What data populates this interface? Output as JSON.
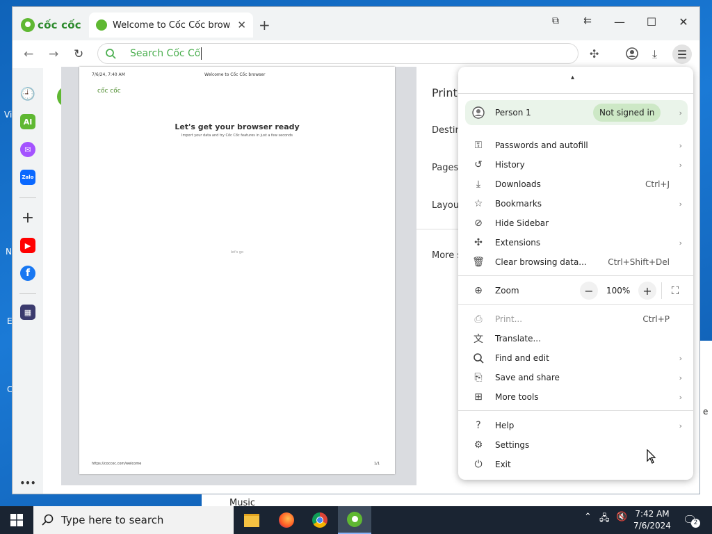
{
  "desktop": {
    "fragments": [
      "Vi",
      "N",
      "E",
      "C"
    ],
    "music_label": "Music",
    "explorer_fragment": "e"
  },
  "browser": {
    "logo_text": "cốc cốc",
    "tab": {
      "title": "Welcome to Cốc Cốc browse",
      "close": "✕"
    },
    "new_tab": "+",
    "window_controls": {
      "minimize": "—",
      "maximize": "☐",
      "close": "✕"
    },
    "omnibox": {
      "placeholder": "Search Cốc Cốc",
      "value": ""
    }
  },
  "print_preview": {
    "header_left": "7/6/24, 7:40 AM",
    "header_center": "Welcome to Cốc Cốc browser",
    "logo": "cốc cốc",
    "heading": "Let's get your browser ready",
    "subheading": "Import your data and try Cốc Cốc features in just a few seconds",
    "center_text": "let's go",
    "footer_left": "https://coccoc.com/welcome",
    "footer_right": "1/1"
  },
  "print_panel": {
    "title": "Print",
    "destination": "Destina",
    "pages": "Pages",
    "layout": "Layout",
    "more": "More s"
  },
  "menu": {
    "collapse": "▴",
    "person": {
      "name": "Person 1",
      "status": "Not signed in"
    },
    "items_1": [
      {
        "label": "Passwords and autofill",
        "shortcut": "",
        "chevron": "›"
      },
      {
        "label": "History",
        "shortcut": "",
        "chevron": "›"
      },
      {
        "label": "Downloads",
        "shortcut": "Ctrl+J",
        "chevron": ""
      },
      {
        "label": "Bookmarks",
        "shortcut": "",
        "chevron": "›"
      },
      {
        "label": "Hide Sidebar",
        "shortcut": "",
        "chevron": ""
      },
      {
        "label": "Extensions",
        "shortcut": "",
        "chevron": "›"
      },
      {
        "label": "Clear browsing data...",
        "shortcut": "Ctrl+Shift+Del",
        "chevron": ""
      }
    ],
    "zoom": {
      "label": "Zoom",
      "value": "100%",
      "minus": "−",
      "plus": "+"
    },
    "items_2": [
      {
        "label": "Print...",
        "shortcut": "Ctrl+P",
        "chevron": ""
      },
      {
        "label": "Translate...",
        "shortcut": "",
        "chevron": ""
      },
      {
        "label": "Find and edit",
        "shortcut": "",
        "chevron": "›"
      },
      {
        "label": "Save and share",
        "shortcut": "",
        "chevron": "›"
      },
      {
        "label": "More tools",
        "shortcut": "",
        "chevron": "›"
      }
    ],
    "items_3": [
      {
        "label": "Help",
        "shortcut": "",
        "chevron": "›"
      },
      {
        "label": "Settings",
        "shortcut": "",
        "chevron": ""
      },
      {
        "label": "Exit",
        "shortcut": "",
        "chevron": ""
      }
    ]
  },
  "sidebar": {
    "ai_label": "AI",
    "zalo_label": "Zalo",
    "more": "•••"
  },
  "taskbar": {
    "search_placeholder": "Type here to search",
    "time": "7:42 AM",
    "date": "7/6/2024",
    "notification_count": "2"
  }
}
